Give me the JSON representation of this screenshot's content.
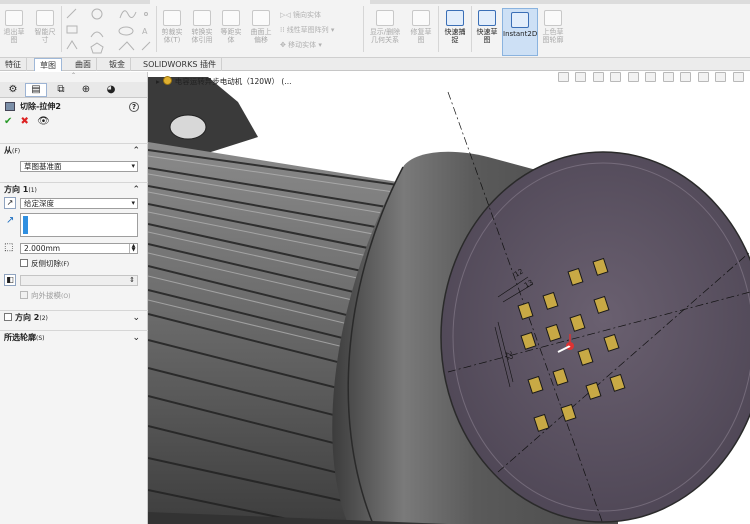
{
  "ribbon": {
    "groups_left": [
      {
        "label": "退出草\n图",
        "name": "exit-sketch"
      },
      {
        "label": "智能尺\n寸",
        "name": "smart-dimension"
      }
    ],
    "trim_label": "剪裁实\n体(T)",
    "convert_label": "转换实\n体引用",
    "offset_label": "等距实\n体",
    "surface_offset_label": "曲面上\n偏移",
    "mirror_label": "镜向实体",
    "linear_pattern_label": "线性草图阵列",
    "move_label": "移动实体",
    "display_relations_label": "显示/删除\n几何关系",
    "repair_label": "修复草\n图",
    "quick_snap_label": "快速捕\n捉",
    "rapid_sketch_label": "快速草\n图",
    "instant2d_label": "Instant2D",
    "shaded_sketch_label": "上色草\n图轮廓"
  },
  "tabs": [
    "特征",
    "草图",
    "曲面",
    "钣金",
    "SOLIDWORKS 插件"
  ],
  "active_tab": 1,
  "property_manager": {
    "title": "切除-拉伸2",
    "help": "?",
    "from_section": {
      "title": "从",
      "hotkey": "(F)",
      "value": "草图基准面"
    },
    "direction1_section": {
      "title": "方向 1",
      "hotkey": "(1)",
      "end_condition": "给定深度",
      "depth": "2.000mm",
      "flip_label": "反侧切除",
      "flip_hotkey": "(F)",
      "draft_label": "向外拔模",
      "draft_hotkey": "(O)"
    },
    "direction2_section": {
      "title": "方向 2",
      "hotkey": "(2)"
    },
    "contours_section": {
      "title": "所选轮廓",
      "hotkey": "(S)"
    }
  },
  "tree": {
    "label": "电容运转异步电动机（120W）",
    "suffix": "(..."
  },
  "dimensions": [
    "12",
    "22",
    "13"
  ],
  "colors": {
    "ribbon_bg": "#f3f3f3",
    "panel_bg": "#f4f4f4",
    "accent": "#2f8fe0",
    "body_metal": "#6e6e6e",
    "face": "#5e5662"
  }
}
